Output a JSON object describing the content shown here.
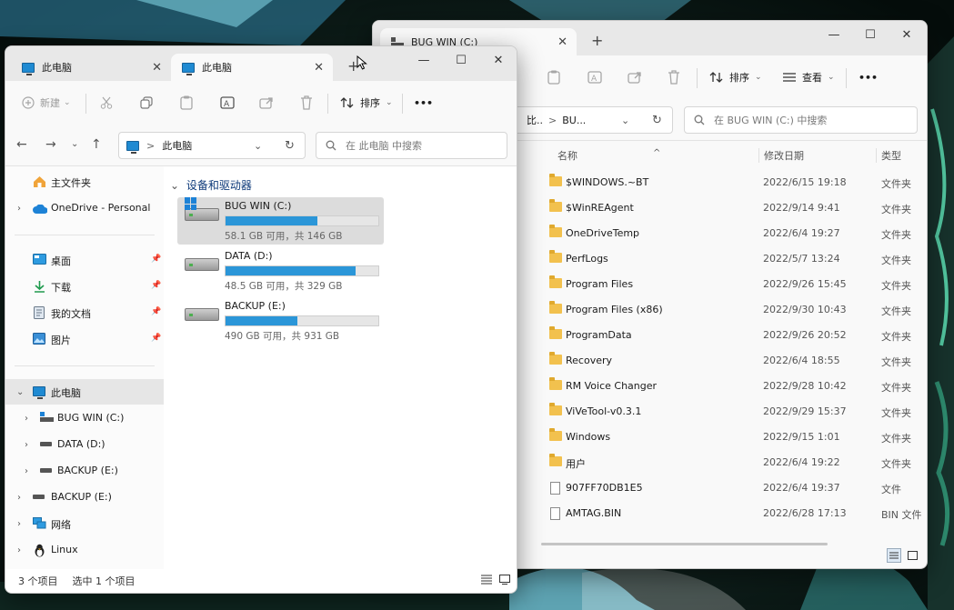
{
  "colors": {
    "accent": "#2b96d8",
    "folder": "#f2c14e",
    "selection": "#dcdcdc"
  },
  "back_window": {
    "tab_title": "BUG WIN (C:)",
    "tab_close": "✕",
    "new_tab": "+",
    "controls": {
      "minimize": "—",
      "maximize": "☐",
      "close": "✕"
    },
    "toolbar": {
      "sort": "排序",
      "view": "查看",
      "more": "•••"
    },
    "address": {
      "segment1": "比..",
      "sep": ">",
      "segment2": "BU..."
    },
    "search_placeholder": "在 BUG WIN (C:) 中搜索",
    "columns": {
      "name": "名称",
      "date": "修改日期",
      "type": "类型"
    },
    "files": [
      {
        "name": "$WINDOWS.~BT",
        "date": "2022/6/15 19:18",
        "type": "文件夹",
        "kind": "folder"
      },
      {
        "name": "$WinREAgent",
        "date": "2022/9/14 9:41",
        "type": "文件夹",
        "kind": "folder"
      },
      {
        "name": "OneDriveTemp",
        "date": "2022/6/4 19:27",
        "type": "文件夹",
        "kind": "folder"
      },
      {
        "name": "PerfLogs",
        "date": "2022/5/7 13:24",
        "type": "文件夹",
        "kind": "folder"
      },
      {
        "name": "Program Files",
        "date": "2022/9/26 15:45",
        "type": "文件夹",
        "kind": "folder"
      },
      {
        "name": "Program Files (x86)",
        "date": "2022/9/30 10:43",
        "type": "文件夹",
        "kind": "folder"
      },
      {
        "name": "ProgramData",
        "date": "2022/9/26 20:52",
        "type": "文件夹",
        "kind": "folder"
      },
      {
        "name": "Recovery",
        "date": "2022/6/4 18:55",
        "type": "文件夹",
        "kind": "folder"
      },
      {
        "name": "RM Voice Changer",
        "date": "2022/9/28 10:42",
        "type": "文件夹",
        "kind": "folder"
      },
      {
        "name": "ViVeTool-v0.3.1",
        "date": "2022/9/29 15:37",
        "type": "文件夹",
        "kind": "folder"
      },
      {
        "name": "Windows",
        "date": "2022/9/15 1:01",
        "type": "文件夹",
        "kind": "folder"
      },
      {
        "name": "用户",
        "date": "2022/6/4 19:22",
        "type": "文件夹",
        "kind": "folder"
      },
      {
        "name": "907FF70DB1E5",
        "date": "2022/6/4 19:37",
        "type": "文件",
        "kind": "file"
      },
      {
        "name": "AMTAG.BIN",
        "date": "2022/6/28 17:13",
        "type": "BIN 文件",
        "kind": "file"
      }
    ]
  },
  "front_window": {
    "tabs": [
      {
        "label": "此电脑",
        "active": false
      },
      {
        "label": "此电脑",
        "active": true
      }
    ],
    "tab_close": "✕",
    "new_tab": "+",
    "controls": {
      "minimize": "—",
      "maximize": "☐",
      "close": "✕"
    },
    "toolbar": {
      "new": "新建",
      "sort": "排序",
      "more": "•••"
    },
    "nav": {
      "back": "←",
      "forward": "→",
      "dropdown": "⌄",
      "up": "↑",
      "refresh": "↻",
      "address_dropdown": "⌄"
    },
    "address": {
      "sep": ">",
      "label": "此电脑"
    },
    "search_placeholder": "在 此电脑 中搜索",
    "sidebar": {
      "home": "主文件夹",
      "onedrive": "OneDrive - Personal",
      "quick": [
        "桌面",
        "下载",
        "我的文档",
        "图片"
      ],
      "this_pc": "此电脑",
      "children": [
        "BUG WIN (C:)",
        "DATA (D:)",
        "BACKUP (E:)"
      ],
      "backup": "BACKUP (E:)",
      "network": "网络",
      "linux": "Linux"
    },
    "group_title": "设备和驱动器",
    "drives": [
      {
        "name": "BUG WIN (C:)",
        "free": "58.1 GB 可用，共 146 GB",
        "used_fraction": 0.6,
        "system": true
      },
      {
        "name": "DATA (D:)",
        "free": "48.5 GB 可用，共 329 GB",
        "used_fraction": 0.85,
        "system": false
      },
      {
        "name": "BACKUP (E:)",
        "free": "490 GB 可用，共 931 GB",
        "used_fraction": 0.47,
        "system": false
      }
    ],
    "status": {
      "count": "3 个项目",
      "selected": "选中 1 个项目"
    }
  }
}
